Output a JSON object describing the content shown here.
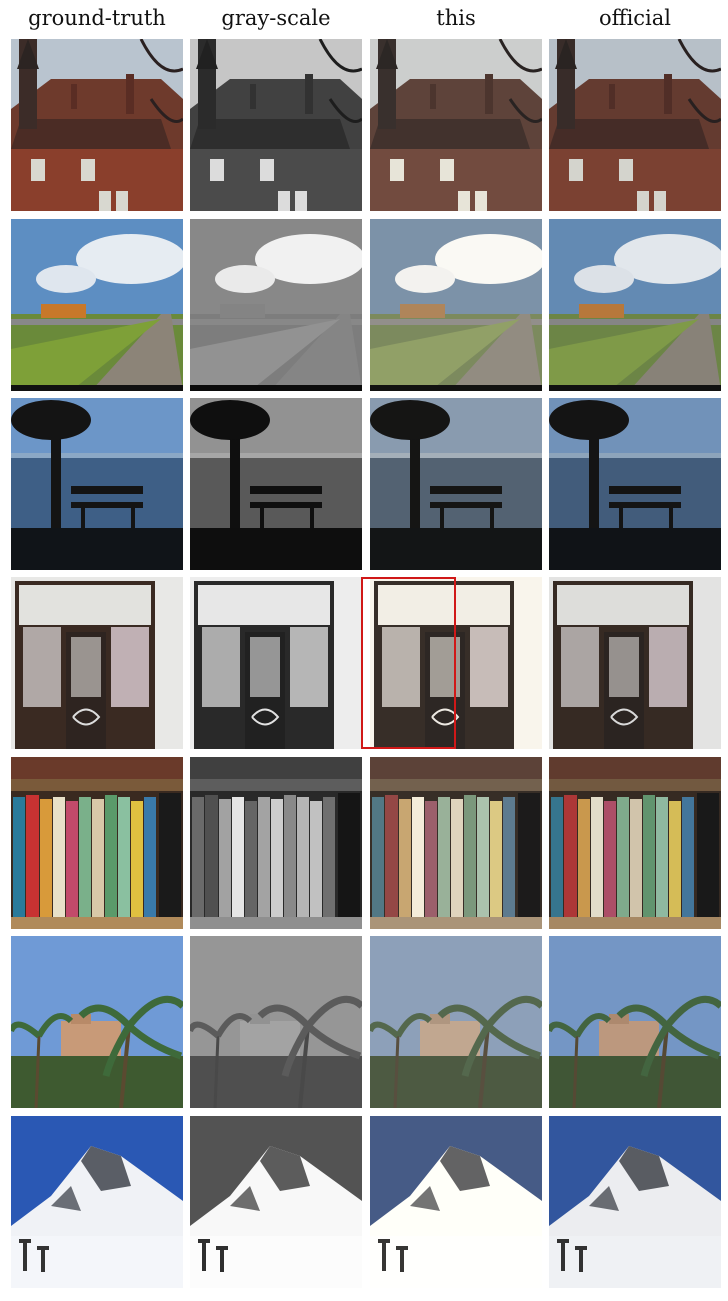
{
  "columns": [
    {
      "label": "ground-truth",
      "style": "truth"
    },
    {
      "label": "gray-scale",
      "style": "gray"
    },
    {
      "label": "this",
      "style": "this"
    },
    {
      "label": "official",
      "style": "official"
    }
  ],
  "rows": [
    {
      "scene": "building"
    },
    {
      "scene": "train"
    },
    {
      "scene": "bench"
    },
    {
      "scene": "door"
    },
    {
      "scene": "books"
    },
    {
      "scene": "palms"
    },
    {
      "scene": "snow"
    }
  ],
  "highlight": {
    "color": "#d01818",
    "column": "this",
    "row": "door"
  }
}
